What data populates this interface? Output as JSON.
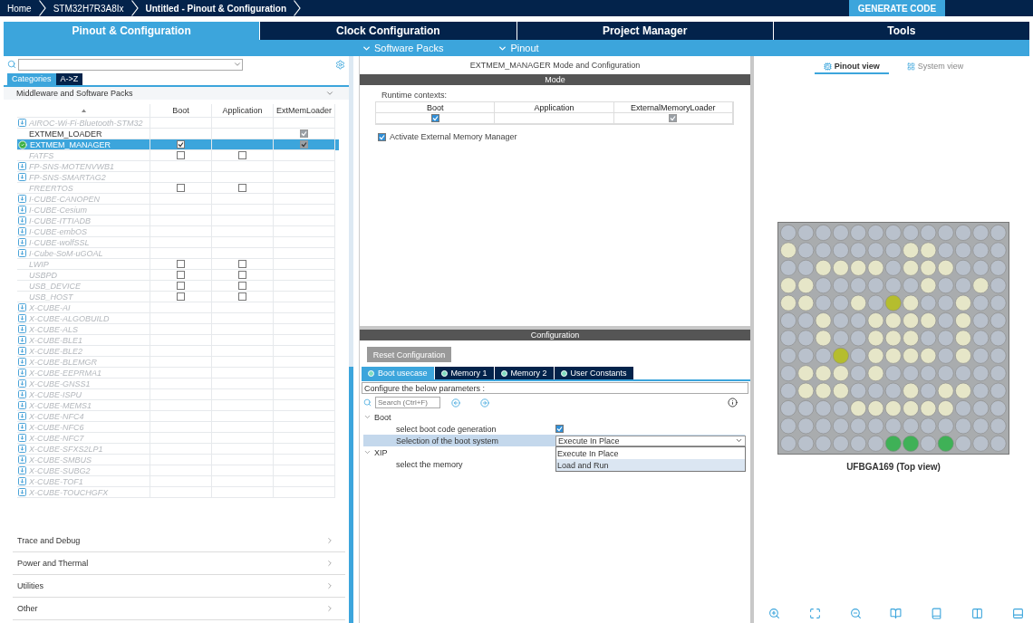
{
  "breadcrumbs": [
    {
      "label": "Home",
      "current": false
    },
    {
      "label": "STM32H7R3A8Ix",
      "current": false
    },
    {
      "label": "Untitled - Pinout & Configuration",
      "current": true
    }
  ],
  "generate_button": "GENERATE CODE",
  "main_tabs": [
    {
      "label": "Pinout & Configuration",
      "selected": true
    },
    {
      "label": "Clock Configuration",
      "selected": false
    },
    {
      "label": "Project Manager",
      "selected": false
    },
    {
      "label": "Tools",
      "selected": false
    }
  ],
  "sub_menus": [
    {
      "label": "Software Packs"
    },
    {
      "label": "Pinout"
    }
  ],
  "left_panel": {
    "view_tabs": [
      {
        "label": "Categories",
        "selected": true
      },
      {
        "label": "A->Z",
        "selected": false
      }
    ],
    "category": {
      "title": "Middleware and Software Packs",
      "expanded": true
    },
    "table": {
      "columns": [
        "Boot",
        "Application",
        "ExtMemLoader"
      ],
      "rows": [
        {
          "name": "AIROC-Wi-Fi-Bluetooth-STM32",
          "kind": "pack",
          "available": false,
          "configured": false,
          "selected": false
        },
        {
          "name": "EXTMEM_LOADER",
          "kind": "component",
          "available": true,
          "configured": false,
          "selected": false,
          "loader_checked": true
        },
        {
          "name": "EXTMEM_MANAGER",
          "kind": "component",
          "available": true,
          "configured": true,
          "selected": true,
          "boot_checked": true,
          "loader_checked": true
        },
        {
          "name": "FATFS",
          "kind": "component",
          "available": false,
          "configured": false,
          "selected": false,
          "boot_checked": false,
          "app_checked": false
        },
        {
          "name": "FP-SNS-MOTENVWB1",
          "kind": "pack",
          "available": false,
          "configured": false,
          "selected": false
        },
        {
          "name": "FP-SNS-SMARTAG2",
          "kind": "pack",
          "available": false,
          "configured": false,
          "selected": false
        },
        {
          "name": "FREERTOS",
          "kind": "component",
          "available": false,
          "configured": false,
          "selected": false,
          "boot_checked": false,
          "app_checked": false
        },
        {
          "name": "I-CUBE-CANOPEN",
          "kind": "pack",
          "available": false,
          "configured": false,
          "selected": false
        },
        {
          "name": "I-CUBE-Cesium",
          "kind": "pack",
          "available": false,
          "configured": false,
          "selected": false
        },
        {
          "name": "I-CUBE-ITTIADB",
          "kind": "pack",
          "available": false,
          "configured": false,
          "selected": false
        },
        {
          "name": "I-CUBE-embOS",
          "kind": "pack",
          "available": false,
          "configured": false,
          "selected": false
        },
        {
          "name": "I-CUBE-wolfSSL",
          "kind": "pack",
          "available": false,
          "configured": false,
          "selected": false
        },
        {
          "name": "I-Cube-SoM-uGOAL",
          "kind": "pack",
          "available": false,
          "configured": false,
          "selected": false
        },
        {
          "name": "LWIP",
          "kind": "component",
          "available": false,
          "configured": false,
          "selected": false,
          "boot_checked": false,
          "app_checked": false
        },
        {
          "name": "USBPD",
          "kind": "component",
          "available": false,
          "configured": false,
          "selected": false,
          "boot_checked": false,
          "app_checked": false
        },
        {
          "name": "USB_DEVICE",
          "kind": "component",
          "available": false,
          "configured": false,
          "selected": false,
          "boot_checked": false,
          "app_checked": false
        },
        {
          "name": "USB_HOST",
          "kind": "component",
          "available": false,
          "configured": false,
          "selected": false,
          "boot_checked": false,
          "app_checked": false
        },
        {
          "name": "X-CUBE-AI",
          "kind": "pack",
          "available": false,
          "configured": false,
          "selected": false
        },
        {
          "name": "X-CUBE-ALGOBUILD",
          "kind": "pack",
          "available": false,
          "configured": false,
          "selected": false
        },
        {
          "name": "X-CUBE-ALS",
          "kind": "pack",
          "available": false,
          "configured": false,
          "selected": false
        },
        {
          "name": "X-CUBE-BLE1",
          "kind": "pack",
          "available": false,
          "configured": false,
          "selected": false
        },
        {
          "name": "X-CUBE-BLE2",
          "kind": "pack",
          "available": false,
          "configured": false,
          "selected": false
        },
        {
          "name": "X-CUBE-BLEMGR",
          "kind": "pack",
          "available": false,
          "configured": false,
          "selected": false
        },
        {
          "name": "X-CUBE-EEPRMA1",
          "kind": "pack",
          "available": false,
          "configured": false,
          "selected": false
        },
        {
          "name": "X-CUBE-GNSS1",
          "kind": "pack",
          "available": false,
          "configured": false,
          "selected": false
        },
        {
          "name": "X-CUBE-ISPU",
          "kind": "pack",
          "available": false,
          "configured": false,
          "selected": false
        },
        {
          "name": "X-CUBE-MEMS1",
          "kind": "pack",
          "available": false,
          "configured": false,
          "selected": false
        },
        {
          "name": "X-CUBE-NFC4",
          "kind": "pack",
          "available": false,
          "configured": false,
          "selected": false
        },
        {
          "name": "X-CUBE-NFC6",
          "kind": "pack",
          "available": false,
          "configured": false,
          "selected": false
        },
        {
          "name": "X-CUBE-NFC7",
          "kind": "pack",
          "available": false,
          "configured": false,
          "selected": false
        },
        {
          "name": "X-CUBE-SFXS2LP1",
          "kind": "pack",
          "available": false,
          "configured": false,
          "selected": false
        },
        {
          "name": "X-CUBE-SMBUS",
          "kind": "pack",
          "available": false,
          "configured": false,
          "selected": false
        },
        {
          "name": "X-CUBE-SUBG2",
          "kind": "pack",
          "available": false,
          "configured": false,
          "selected": false
        },
        {
          "name": "X-CUBE-TOF1",
          "kind": "pack",
          "available": false,
          "configured": false,
          "selected": false
        },
        {
          "name": "X-CUBE-TOUCHGFX",
          "kind": "pack",
          "available": false,
          "configured": false,
          "selected": false
        }
      ]
    },
    "categories": [
      {
        "title": "Trace and Debug",
        "expanded": false
      },
      {
        "title": "Power and Thermal",
        "expanded": false
      },
      {
        "title": "Utilities",
        "expanded": false
      },
      {
        "title": "Other",
        "expanded": false
      }
    ]
  },
  "middle": {
    "title": "EXTMEM_MANAGER Mode and Configuration",
    "mode_header": "Mode",
    "runtime_label": "Runtime contexts:",
    "runtime_table": {
      "columns": [
        "Boot",
        "Application",
        "ExternalMemoryLoader"
      ],
      "cells": [
        {
          "kind": "checkbox",
          "checked": true,
          "disabled": false
        },
        {
          "kind": "empty"
        },
        {
          "kind": "checkbox",
          "checked": true,
          "disabled": true
        }
      ]
    },
    "activate": {
      "label": "Activate External Memory Manager",
      "checked": true
    },
    "config_header": "Configuration",
    "reset_button": {
      "label": "Reset Configuration",
      "disabled": true
    },
    "config_tabs": [
      {
        "label": "Boot usecase",
        "selected": true
      },
      {
        "label": "Memory 1",
        "selected": false
      },
      {
        "label": "Memory 2",
        "selected": false
      },
      {
        "label": "User Constants",
        "selected": false
      }
    ],
    "description": "Configure the below parameters :",
    "search": {
      "placeholder": "Search (Ctrl+F)"
    },
    "groups": [
      {
        "title": "Boot",
        "expanded": true,
        "params": [
          {
            "label": "select boot code generation",
            "kind": "checkbox",
            "checked": true,
            "selected": false
          },
          {
            "label": "Selection of the boot system",
            "kind": "select",
            "value": "Execute In Place",
            "selected": true,
            "expanded": true,
            "options": [
              {
                "label": "Execute In Place",
                "highlighted": false
              },
              {
                "label": "Load and Run",
                "highlighted": true
              }
            ]
          }
        ]
      },
      {
        "title": "XIP",
        "expanded": true,
        "params": [
          {
            "label": "select the memory",
            "kind": "blank",
            "selected": false
          }
        ]
      }
    ]
  },
  "right_panel": {
    "view_tabs": [
      {
        "label": "Pinout view",
        "selected": true
      },
      {
        "label": "System view",
        "selected": false
      }
    ],
    "package_label": "UFBGA169 (Top view)"
  }
}
